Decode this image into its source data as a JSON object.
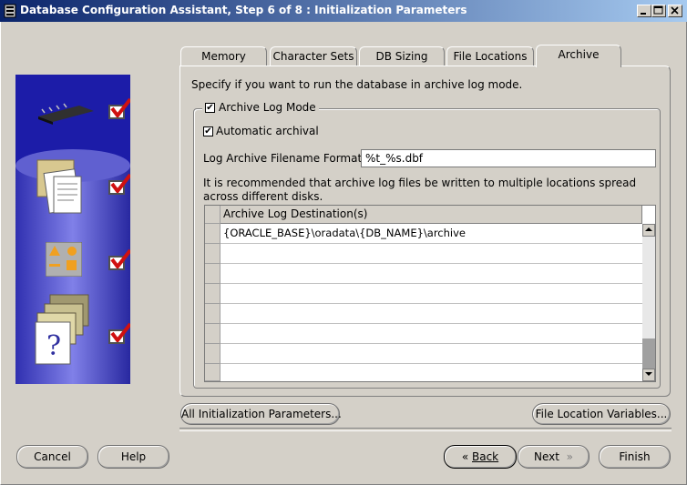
{
  "window": {
    "title": "Database Configuration Assistant, Step 6 of 8 : Initialization Parameters"
  },
  "tabs": [
    {
      "label": "Memory",
      "active": false
    },
    {
      "label": "Character Sets",
      "active": false
    },
    {
      "label": "DB Sizing",
      "active": false
    },
    {
      "label": "File Locations",
      "active": false
    },
    {
      "label": "Archive",
      "active": true
    }
  ],
  "archive": {
    "intro": "Specify if you want to run the database in archive log mode.",
    "archive_log_mode_label": "Archive Log Mode",
    "archive_log_mode_checked": true,
    "automatic_archival_label": "Automatic archival",
    "automatic_archival_checked": true,
    "format_label": "Log Archive Filename Format:",
    "format_value": "%t_%s.dbf",
    "recommendation": "It is recommended that archive log files be written to multiple locations spread across different disks.",
    "table": {
      "column_header": "Archive Log Destination(s)",
      "rows": [
        "{ORACLE_BASE}\\oradata\\{DB_NAME}\\archive",
        "",
        "",
        "",
        "",
        "",
        "",
        ""
      ]
    }
  },
  "buttons": {
    "all_params": "All Initialization Parameters...",
    "file_location_vars": "File Location Variables...",
    "cancel": "Cancel",
    "help": "Help",
    "back": "Back",
    "next": "Next",
    "finish": "Finish"
  },
  "icons": [
    "oracle-app-icon",
    "minimize-icon",
    "maximize-icon",
    "close-icon",
    "chip-icon",
    "documents-icon",
    "shapes-icon",
    "folders-help-icon",
    "checkmark-icon"
  ],
  "colors": {
    "titlebar_start": "#0a246a",
    "titlebar_end": "#a6caf0",
    "side_panel": "#1c1ca8",
    "check_red": "#d01010"
  }
}
